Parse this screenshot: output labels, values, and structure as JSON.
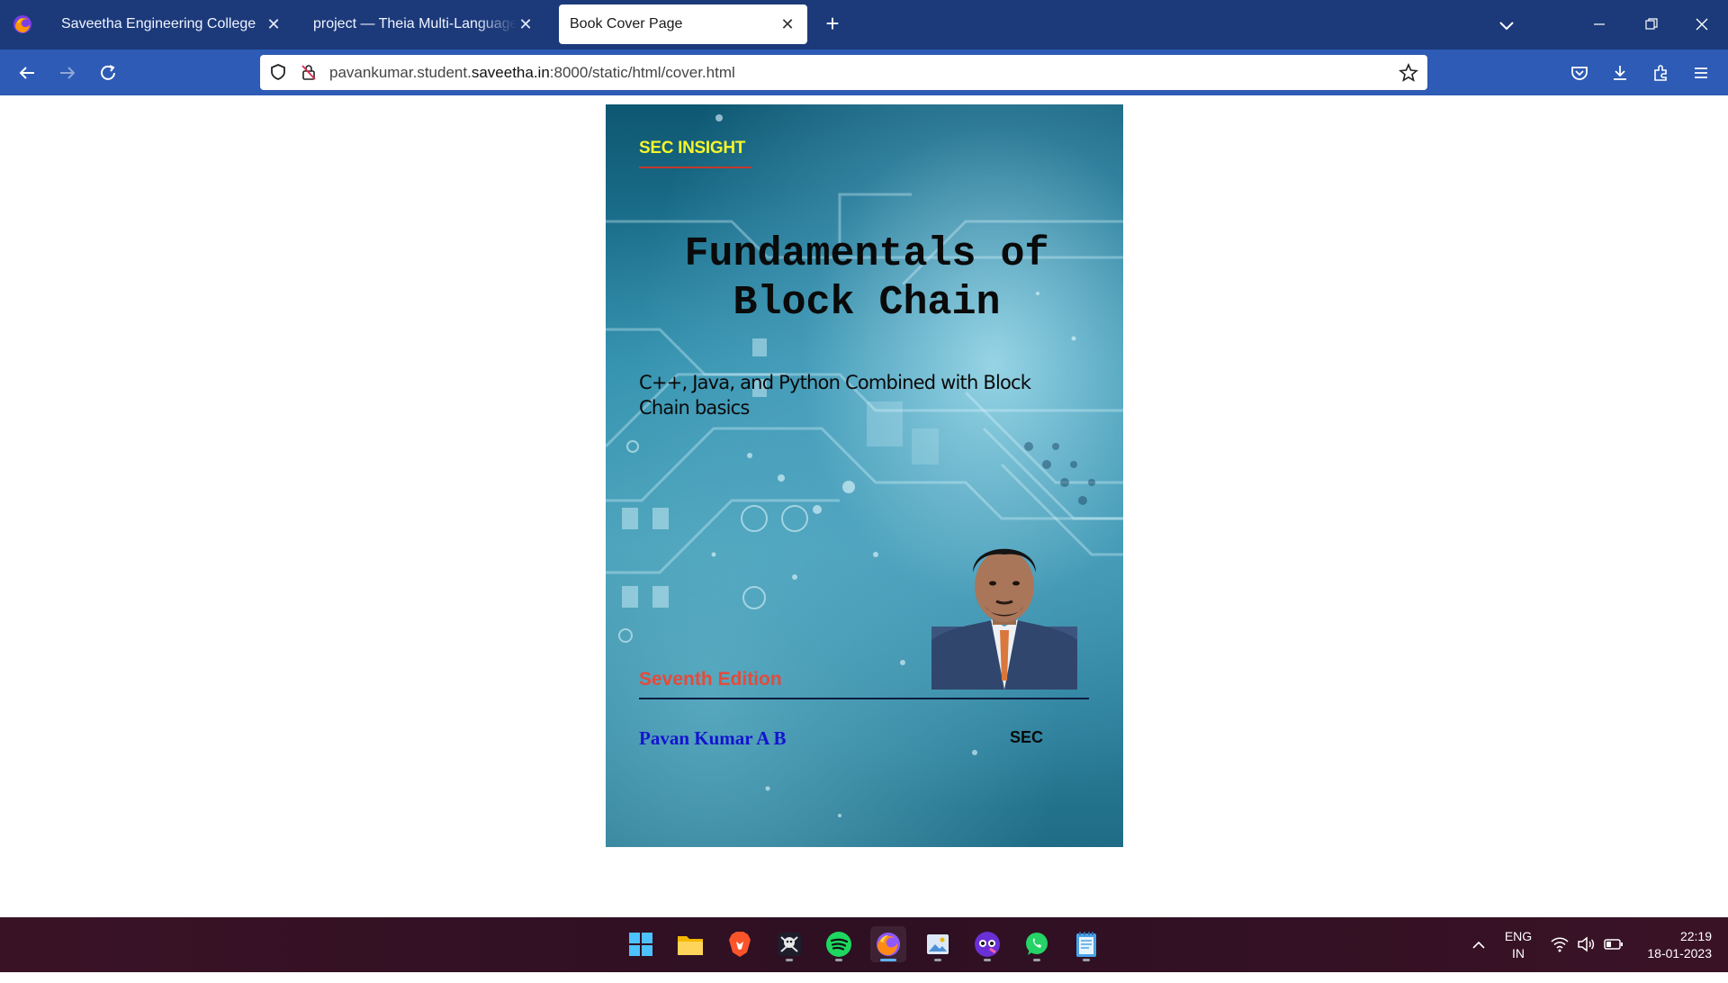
{
  "browser": {
    "tabs": [
      {
        "label": "Saveetha Engineering College",
        "active": false
      },
      {
        "label": "project — Theia Multi-Language Example",
        "active": false
      },
      {
        "label": "Book Cover Page",
        "active": true
      }
    ],
    "url": {
      "host_prefix": "pavankumar.student.",
      "host": "saveetha.in",
      "rest": ":8000/static/html/cover.html"
    },
    "accent_color": "#1c3a7a",
    "toolbar_color": "#2d5bb5"
  },
  "cover": {
    "publisher_brand": "SEC INSIGHT",
    "title": "Fundamentals of Block Chain",
    "subtitle": "C++, Java, and Python Combined with Block Chain basics",
    "edition": "Seventh Edition",
    "author": "Pavan Kumar A B",
    "publisher": "SEC",
    "colors": {
      "brand": "#f5f52a",
      "edition": "#e64a3a",
      "author": "#1414d0",
      "background": "#2a8aa8"
    }
  },
  "taskbar": {
    "apps": [
      {
        "name": "start-icon",
        "active": false
      },
      {
        "name": "file-explorer-icon",
        "active": false
      },
      {
        "name": "brave-browser-icon",
        "active": false
      },
      {
        "name": "pirate-app-icon",
        "active": false
      },
      {
        "name": "spotify-icon",
        "active": false
      },
      {
        "name": "firefox-icon",
        "active": true
      },
      {
        "name": "image-viewer-icon",
        "active": false
      },
      {
        "name": "game-app-icon",
        "active": false
      },
      {
        "name": "whatsapp-icon",
        "active": false
      },
      {
        "name": "notepad-icon",
        "active": false
      }
    ],
    "language": {
      "line1": "ENG",
      "line2": "IN"
    },
    "clock": {
      "time": "22:19",
      "date": "18-01-2023"
    }
  }
}
